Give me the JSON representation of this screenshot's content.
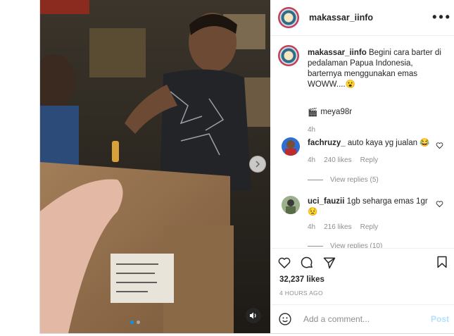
{
  "account": {
    "username": "makassar_iinfo"
  },
  "media": {
    "slide_count": 2,
    "active_slide": 1
  },
  "caption": {
    "username": "makassar_iinfo",
    "text": "Begini cara barter di pedalaman Papua Indonesia, barternya menggunakan emas WOWW....😮",
    "tag_icon": "🎬",
    "tag_user": "meya98r",
    "time": "4h"
  },
  "comments": [
    {
      "username": "fachruzy_",
      "text": "auto kaya yg jualan 😂",
      "time": "4h",
      "likes": "240 likes",
      "reply": "Reply",
      "view_replies": "View replies (5)"
    },
    {
      "username": "uci_fauzii",
      "text": "1gb seharga emas 1gr 😟",
      "time": "4h",
      "likes": "216 likes",
      "reply": "Reply",
      "view_replies": "View replies (10)"
    }
  ],
  "stats": {
    "likes": "32,237 likes",
    "time_ago": "4 HOURS AGO"
  },
  "add_comment": {
    "placeholder": "Add a comment...",
    "post_label": "Post"
  },
  "colors": {
    "accent": "#0095f6",
    "post_disabled": "#b2dffc",
    "muted": "#8e8e8e",
    "border": "#dbdbdb"
  },
  "icons": [
    "more-options-icon",
    "heart-icon",
    "comment-icon",
    "share-icon",
    "bookmark-icon",
    "emoji-icon",
    "sound-icon",
    "chevron-right-icon",
    "clapper-icon"
  ]
}
